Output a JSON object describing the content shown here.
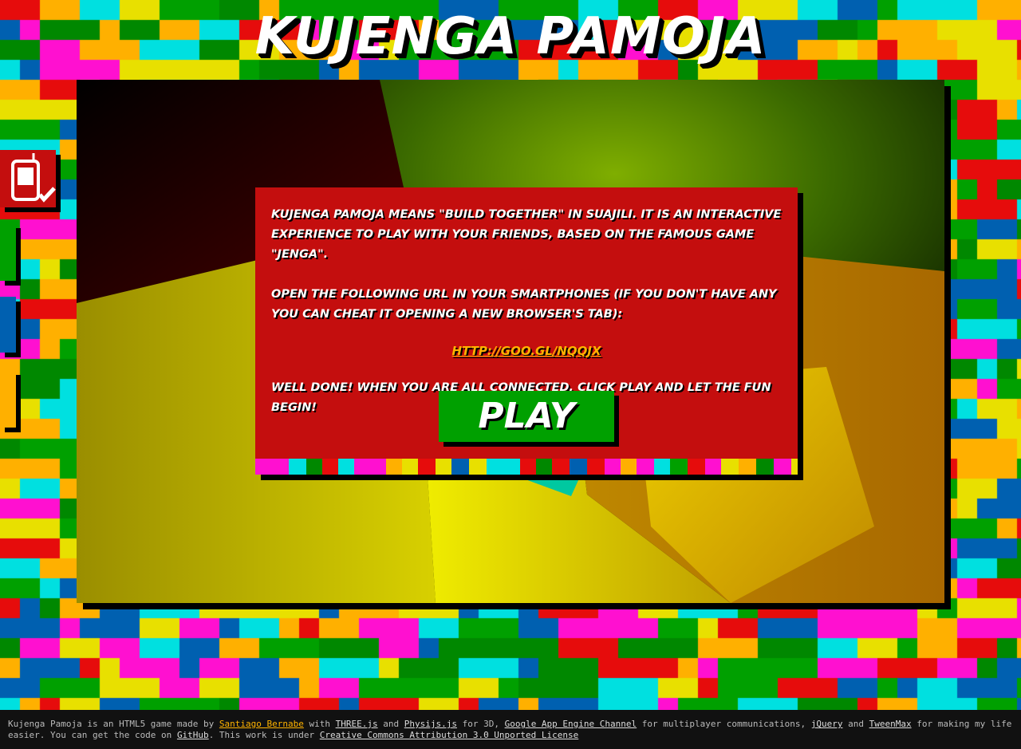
{
  "title": "Kujenga Pamoja",
  "colors": {
    "red": "#e60c0c",
    "green": "#00a000",
    "blue": "#0060b0",
    "yellow": "#e8e000",
    "orange": "#ffb000",
    "magenta": "#ff10d0",
    "cyan": "#00e0e0",
    "darkgreen": "#008800",
    "panel": "#c40e0e",
    "link": "#ffb300"
  },
  "phone_icon": "smartphone-check-icon",
  "panel": {
    "intro": "Kujenga Pamoja means \"build together\" in Suajili. It is an interactive experience to play with your friends, based on the famous game \"Jenga\".",
    "instructions": "Open the following URL in your smartphones (if you don't have any you can cheat it opening a new browser's tab):",
    "url": "http://goo.gl/nQqjx",
    "connected": "Well done! When you are all connected, click play and let the fun begin!",
    "play_label": "Play"
  },
  "footer": {
    "t1": "Kujenga Pamoja is an HTML5 game made by",
    "author": "Santiago Bernabe",
    "t2": "with",
    "threejs": "THREE.js",
    "t3": "and",
    "physijs": "Physijs.js",
    "t4": "for 3D,",
    "channel": "Google App Engine Channel",
    "t5": "for multiplayer communications,",
    "jquery": "jQuery",
    "t6": "and",
    "tweenmax": "TweenMax",
    "t7": "for making my life easier. You can get the code on",
    "github": "GitHub",
    "t8": ". This work is under",
    "license": "Creative Commons Attribution 3.0 Unported License"
  }
}
